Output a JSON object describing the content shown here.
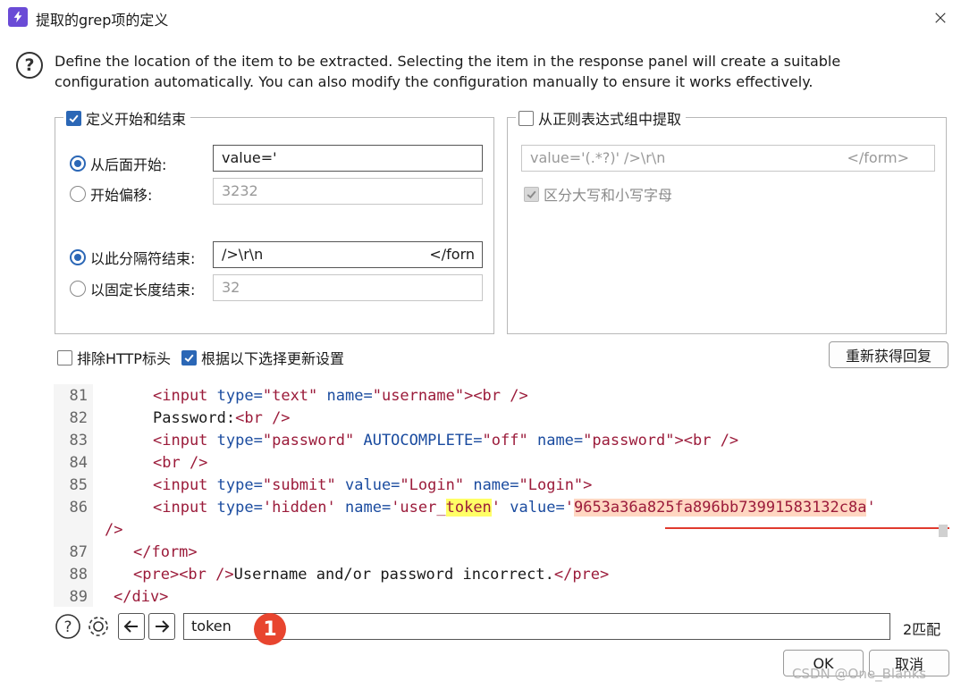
{
  "window": {
    "title": "提取的grep项的定义",
    "close_label": "✕",
    "app_icon": "bolt-icon"
  },
  "description": "Define the location of the item to be extracted. Selecting the item in the response panel will create a suitable configuration automatically. You can also modify the configuration manually to ensure it works effectively.",
  "left_group": {
    "legend": "定义开始和结束",
    "checked": true,
    "start_after": {
      "label": "从后面开始:",
      "selected": true,
      "value": "value='"
    },
    "start_offset": {
      "label": "开始偏移:",
      "selected": false,
      "value": "3232"
    },
    "end_delimiter": {
      "label": "以此分隔符结束:",
      "selected": true,
      "value": "/>\\r\\n",
      "value_right": "</forn"
    },
    "end_fixed_length": {
      "label": "以固定长度结束:",
      "selected": false,
      "value": "32"
    }
  },
  "right_group": {
    "legend": "从正则表达式组中提取",
    "checked": false,
    "regex_value": "value='(.*?)' />\\r\\n",
    "regex_value_right": "</form>",
    "case_sensitive_label": "区分大写和小写字母",
    "case_sensitive_checked": true
  },
  "options": {
    "exclude_http_headers_label": "排除HTTP标头",
    "exclude_http_headers_checked": false,
    "update_config_label": "根据以下选择更新设置",
    "update_config_checked": true,
    "refetch_response_label": "重新获得回复"
  },
  "code": {
    "lines": [
      {
        "n": "81",
        "t1": "<input",
        "t2": "type=",
        "t3": "\"text\"",
        "t4": "name=",
        "t5": "\"username\"",
        "t6": "><br />"
      },
      {
        "n": "82",
        "a": "Password:",
        "b": "<br />"
      },
      {
        "n": "83",
        "t1": "<input",
        "t2": "type=",
        "t3": "\"password\"",
        "t4": "AUTOCOMPLETE=",
        "t5": "\"off\"",
        "t6": "name=",
        "t7": "\"password\"",
        "t8": "><br />"
      },
      {
        "n": "84",
        "a": "<br />"
      },
      {
        "n": "85",
        "t1": "<input",
        "t2": "type=",
        "t3": "\"submit\"",
        "t4": "value=",
        "t5": "\"Login\"",
        "t6": "name=",
        "t7": "\"Login\"",
        "t8": ">"
      },
      {
        "n": "86",
        "t1": "<input",
        "t2": "type=",
        "t3": "'hidden'",
        "t4": "name=",
        "t5a": "'user_",
        "t5b": "token",
        "t5c": "'",
        "t6": "value=",
        "t7a": "'",
        "t7b": "9653a36a825fa896bb73991583132c8a",
        "t7c": "'",
        "wrap": "/>"
      },
      {
        "n": "87",
        "a": "</form>"
      },
      {
        "n": "88",
        "a": "<pre>",
        "b": "<br />",
        "c": "Username and/or password incorrect.",
        "d": "</pre>"
      },
      {
        "n": "89",
        "a": "</div>"
      }
    ]
  },
  "search": {
    "value": "token",
    "match_count": "2匹配",
    "annotation_number": "1"
  },
  "buttons": {
    "ok": "OK",
    "cancel": "取消"
  },
  "watermark": "CSDN @One_Blanks",
  "colors": {
    "accent": "#2b67b6",
    "highlight_yellow": "#ffff66",
    "highlight_selection": "#ffd7c2",
    "annotation_red": "#e8452f"
  }
}
